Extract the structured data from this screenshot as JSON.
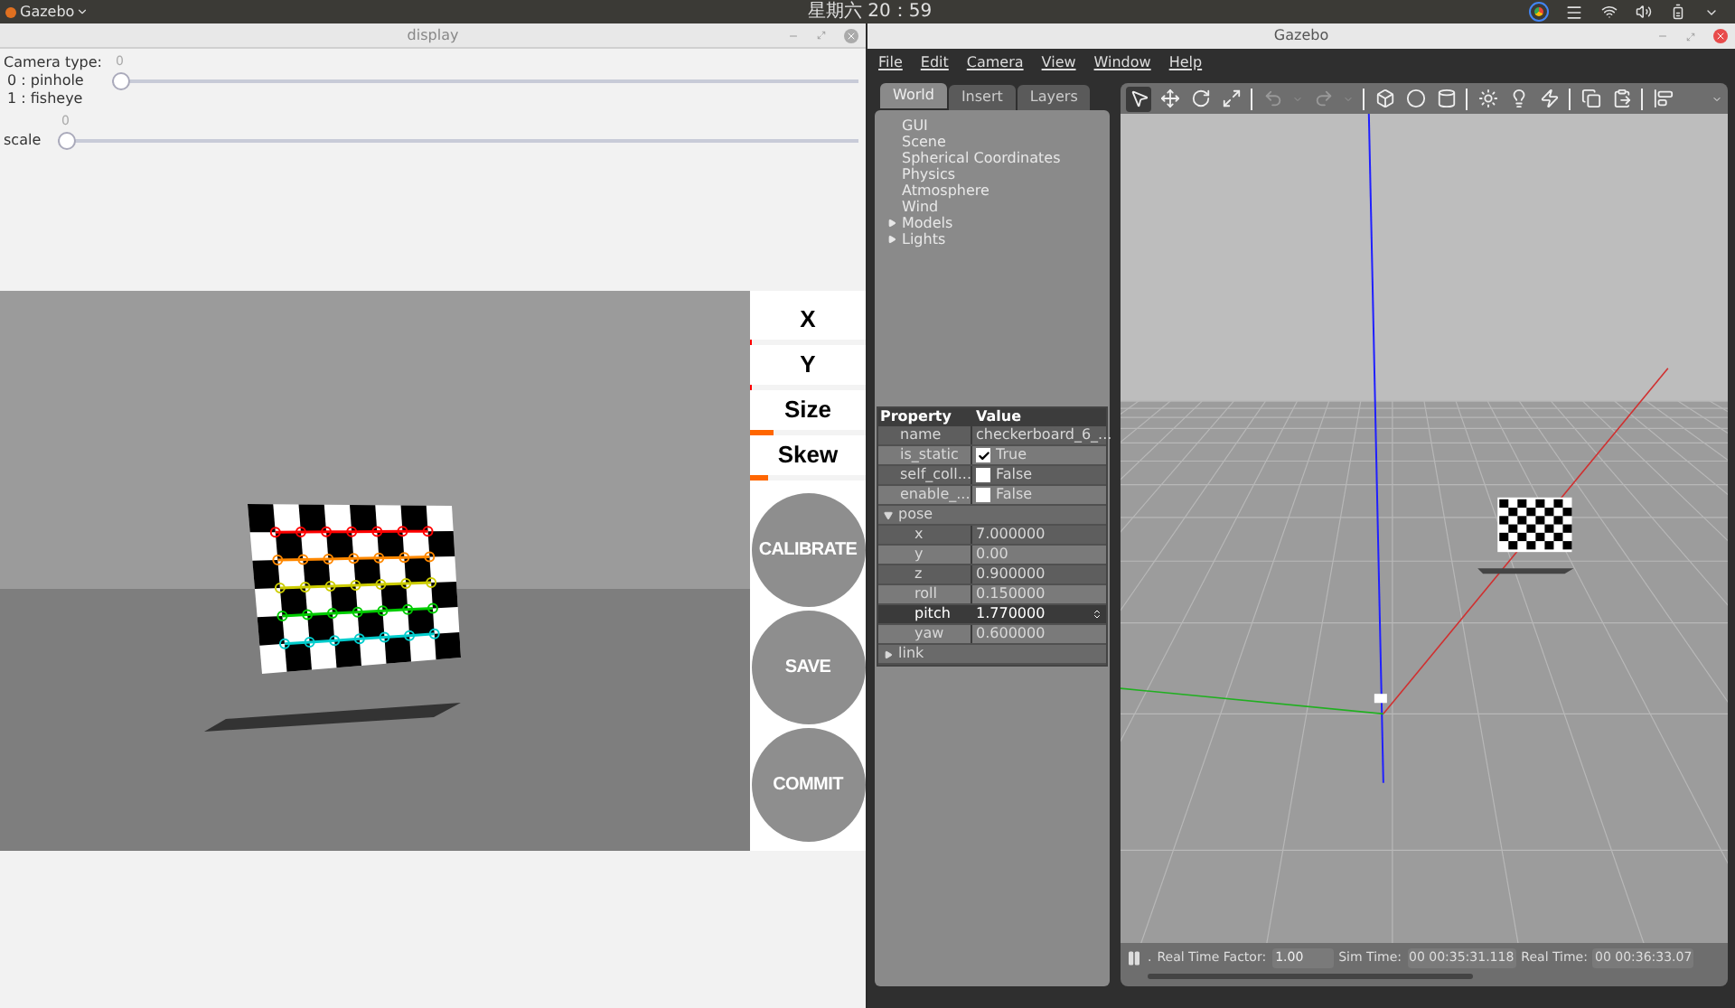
{
  "top_bar": {
    "app_menu": "Gazebo",
    "clock": "星期六 20：59"
  },
  "display_window": {
    "title": "display",
    "camera_type": {
      "label": "Camera type:",
      "options": [
        "0 : pinhole",
        "1 : fisheye"
      ],
      "value": "0",
      "level": 0
    },
    "scale": {
      "label": "scale",
      "value": "0",
      "level": 0
    },
    "metrics": [
      {
        "label": "X",
        "level": 0.02,
        "color": "#ff0000"
      },
      {
        "label": "Y",
        "level": 0.02,
        "color": "#ff0000"
      },
      {
        "label": "Size",
        "level": 0.2,
        "color": "#ff6600"
      },
      {
        "label": "Skew",
        "level": 0.15,
        "color": "#ff6600"
      }
    ],
    "buttons": [
      {
        "label": "CALIBRATE",
        "disabled": true
      },
      {
        "label": "SAVE",
        "disabled": true
      },
      {
        "label": "COMMIT",
        "disabled": true
      }
    ]
  },
  "gazebo_window": {
    "title": "Gazebo",
    "menu": [
      "File",
      "Edit",
      "Camera",
      "View",
      "Window",
      "Help"
    ],
    "tabs": [
      {
        "label": "World",
        "selected": true
      },
      {
        "label": "Insert",
        "selected": false
      },
      {
        "label": "Layers",
        "selected": false
      }
    ],
    "tree": [
      {
        "label": "GUI",
        "kind": "leaf"
      },
      {
        "label": "Scene",
        "kind": "leaf"
      },
      {
        "label": "Spherical Coordinates",
        "kind": "leaf"
      },
      {
        "label": "Physics",
        "kind": "leaf"
      },
      {
        "label": "Atmosphere",
        "kind": "leaf"
      },
      {
        "label": "Wind",
        "kind": "leaf"
      },
      {
        "label": "Models",
        "kind": "group",
        "expanded": false
      },
      {
        "label": "Lights",
        "kind": "group",
        "expanded": false
      }
    ],
    "properties": {
      "columns": [
        "Property",
        "Value"
      ],
      "rows": [
        {
          "name": "name",
          "value": "checkerboard_6_...",
          "kind": "text",
          "selected": false
        },
        {
          "name": "is_static",
          "value": "True",
          "kind": "check",
          "checked": true,
          "selected": false
        },
        {
          "name": "self_coll...",
          "value": "False",
          "kind": "check",
          "checked": false,
          "selected": false
        },
        {
          "name": "enable_...",
          "value": "False",
          "kind": "check",
          "checked": false,
          "selected": false
        },
        {
          "name": "pose",
          "kind": "group",
          "expanded": true,
          "selected": false,
          "children": [
            {
              "name": "x",
              "value": "7.000000",
              "kind": "text",
              "selected": false
            },
            {
              "name": "y",
              "value": "0.00",
              "kind": "text",
              "selected": false
            },
            {
              "name": "z",
              "value": "0.900000",
              "kind": "text",
              "selected": false
            },
            {
              "name": "roll",
              "value": "0.150000",
              "kind": "text",
              "selected": false
            },
            {
              "name": "pitch",
              "value": "1.770000",
              "kind": "spin",
              "selected": true
            },
            {
              "name": "yaw",
              "value": "0.600000",
              "kind": "text",
              "selected": false
            }
          ]
        },
        {
          "name": "link",
          "kind": "group",
          "expanded": false,
          "selected": false,
          "children": []
        }
      ]
    },
    "tools": [
      {
        "kind": "select",
        "selected": true
      },
      {
        "kind": "move",
        "selected": false
      },
      {
        "kind": "rotate",
        "selected": false
      },
      {
        "kind": "scale",
        "selected": false
      },
      {
        "kind": "sep"
      },
      {
        "kind": "undo",
        "selected": false
      },
      {
        "kind": "caret",
        "selected": false
      },
      {
        "kind": "redo",
        "selected": false
      },
      {
        "kind": "caret",
        "selected": false
      },
      {
        "kind": "sep"
      },
      {
        "kind": "box",
        "selected": false
      },
      {
        "kind": "sphere",
        "selected": false
      },
      {
        "kind": "cylinder",
        "selected": false
      },
      {
        "kind": "sep"
      },
      {
        "kind": "sun",
        "selected": false
      },
      {
        "kind": "point",
        "selected": false
      },
      {
        "kind": "spot",
        "selected": false
      },
      {
        "kind": "sep"
      },
      {
        "kind": "copy",
        "selected": false
      },
      {
        "kind": "paste",
        "selected": false
      },
      {
        "kind": "sep"
      },
      {
        "kind": "align",
        "selected": false
      }
    ],
    "status": {
      "dot": ".",
      "rtf_label": "Real Time Factor:",
      "rtf": "1.00",
      "sim_label": "Sim Time:",
      "sim": "00 00:35:31.118",
      "real_label": "Real Time:",
      "real": "00 00:36:33.07"
    }
  }
}
